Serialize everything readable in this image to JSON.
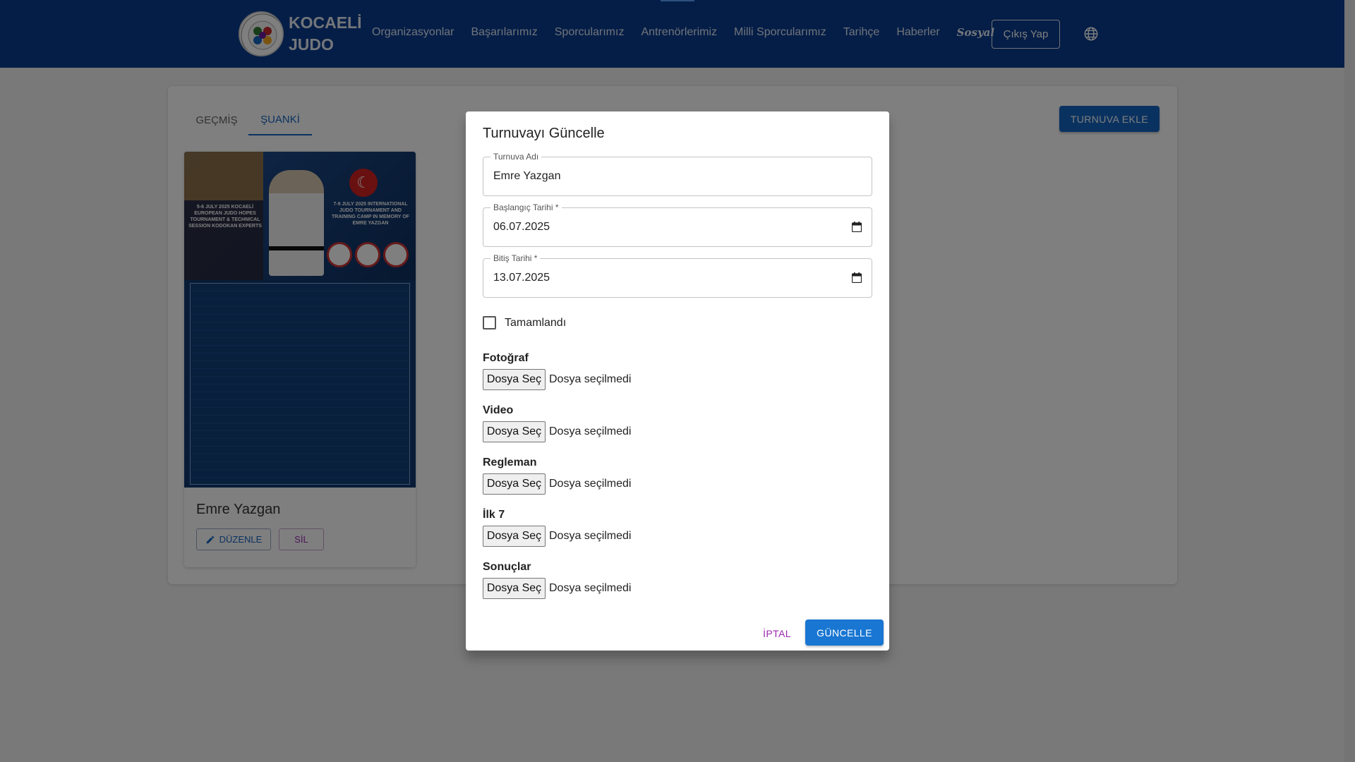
{
  "header": {
    "logo_text": "KOCAELİ JUDO",
    "logo_lines": [
      "KOCAELİ",
      "JUDO"
    ],
    "logo_ring_text": "KOCAELİ JUDO",
    "nav": [
      "Organizasyonlar",
      "Başarılarımız",
      "Sporcularımız",
      "Antrenörlerimiz",
      "Milli Sporcularımız",
      "Tarihçe",
      "Haberler",
      "Sosyal"
    ],
    "logout_label": "Çıkış Yap",
    "globe_icon": "globe-icon"
  },
  "page": {
    "tabs": [
      "GEÇMİŞ",
      "ŞUANKİ"
    ],
    "active_tab": "ŞUANKİ",
    "add_button_label": "TURNUVA EKLE",
    "card": {
      "title": "Emre Yazgan",
      "edit_label": "DÜZENLE",
      "delete_label": "SİL",
      "poster_left_text": "5-6 JULY 2025 KOCAELİ EUROPEAN JUDO HOPES TOURNAMENT & TECHNICAL SESSION KODOKAN EXPERTS",
      "poster_right_text": "7-9 JULY 2025 INTERNATIONAL JUDO TOURNAMENT AND TRAINING CAMP IN MEMORY OF EMRE YAZGAN"
    }
  },
  "modal": {
    "title": "Turnuvayı Güncelle",
    "fields": {
      "name": {
        "label": "Turnuva Adı",
        "value": "Emre Yazgan"
      },
      "start": {
        "label": "Başlangıç Tarihi *",
        "value": "06.07.2025"
      },
      "end": {
        "label": "Bitiş Tarihi *",
        "value": "13.07.2025"
      }
    },
    "completed_label": "Tamamlandı",
    "completed_checked": false,
    "files": [
      {
        "label": "Fotoğraf",
        "button": "Dosya Seç",
        "status": "Dosya seçilmedi"
      },
      {
        "label": "Video",
        "button": "Dosya Seç",
        "status": "Dosya seçilmedi"
      },
      {
        "label": "Regleman",
        "button": "Dosya Seç",
        "status": "Dosya seçilmedi"
      },
      {
        "label": "İlk 7",
        "button": "Dosya Seç",
        "status": "Dosya seçilmedi"
      },
      {
        "label": "Sonuçlar",
        "button": "Dosya Seç",
        "status": "Dosya seçilmedi"
      }
    ],
    "cancel_label": "İPTAL",
    "update_label": "GÜNCELLE"
  },
  "colors": {
    "header_bg": "#0a3d8f",
    "primary": "#1565c0",
    "secondary": "#9c27b0"
  }
}
